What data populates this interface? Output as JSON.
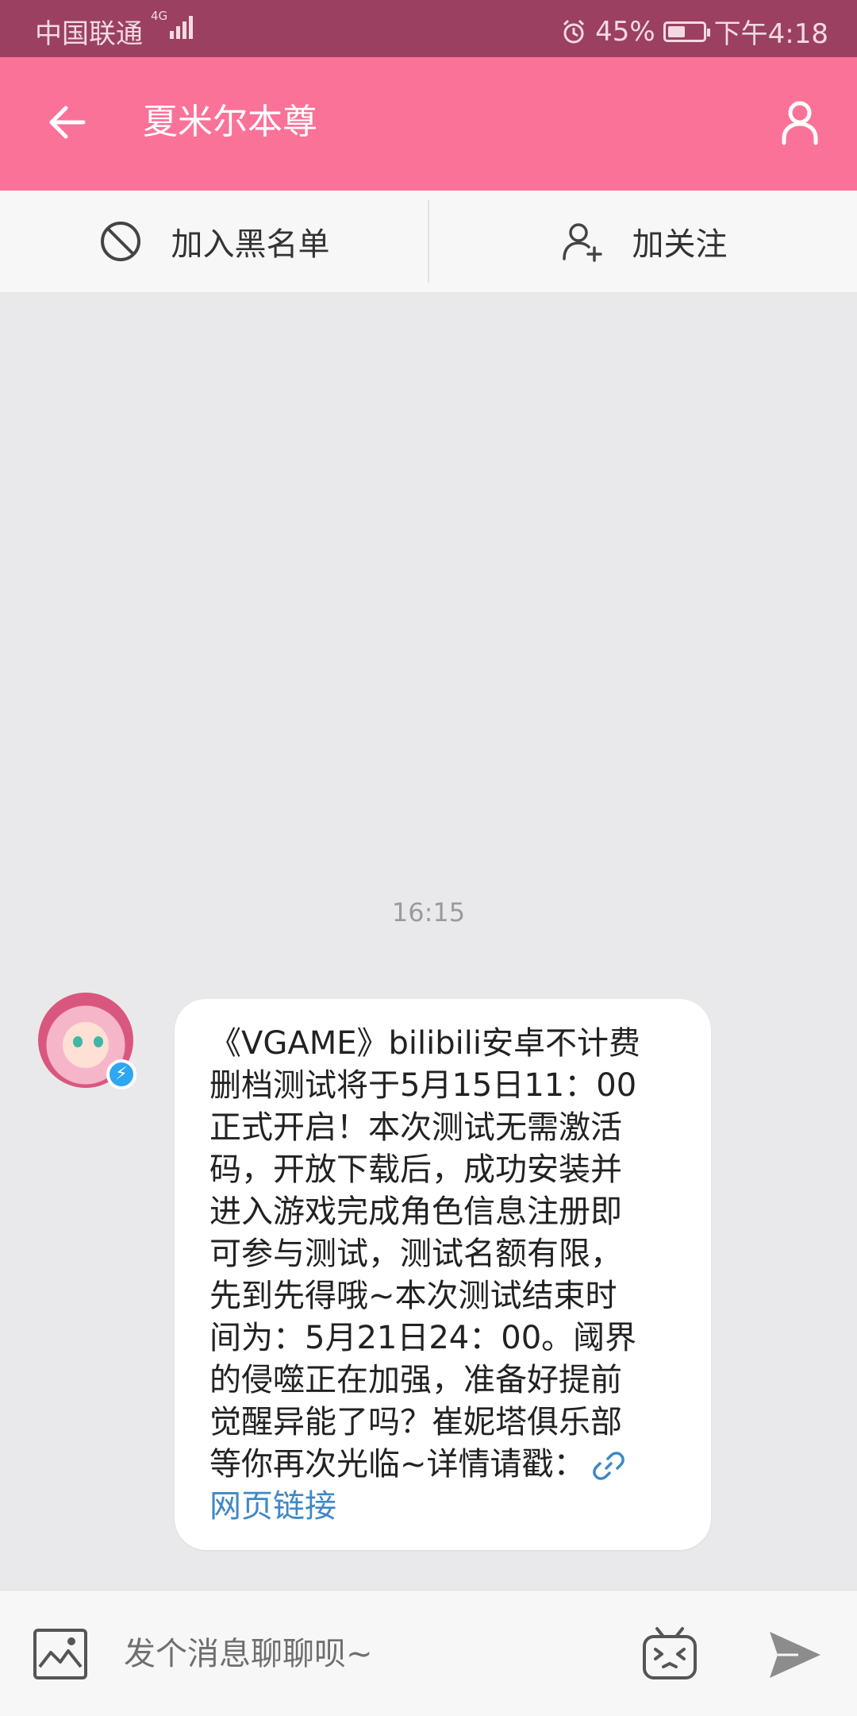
{
  "status_bar": {
    "carrier": "中国联通",
    "network": "4G",
    "battery": "45%",
    "time": "下午4:18"
  },
  "header": {
    "title": "夏米尔本尊"
  },
  "actions": {
    "blacklist_label": "加入黑名单",
    "follow_label": "加关注"
  },
  "chat": {
    "timestamp": "16:15",
    "message_lines": [
      "《VGAME》bilibili安卓不计费",
      "删档测试将于5月15日11：00",
      "正式开启！本次测试无需激活",
      "码，开放下载后，成功安装并",
      "进入游戏完成角色信息注册即",
      "可参与测试，测试名额有限，",
      "先到先得哦~本次测试结束时",
      "间为：5月21日24：00。阈界",
      "的侵噬正在加强，准备好提前",
      "觉醒异能了吗？崔妮塔俱乐部",
      "等你再次光临~详情请戳："
    ],
    "link_text": "网页链接"
  },
  "composer": {
    "placeholder": "发个消息聊聊呗~"
  },
  "icons": {
    "back": "arrow-left-icon",
    "profile": "user-icon",
    "block": "block-icon",
    "follow": "add-user-icon",
    "link": "link-icon",
    "image": "image-icon",
    "emoji": "bilibili-emoji-icon",
    "send": "send-icon",
    "verified": "lightning-badge-icon"
  },
  "colors": {
    "header_bg": "#fb7299",
    "status_bg": "#9b4060",
    "link": "#3f88c5",
    "badge": "#2ea7f0"
  }
}
